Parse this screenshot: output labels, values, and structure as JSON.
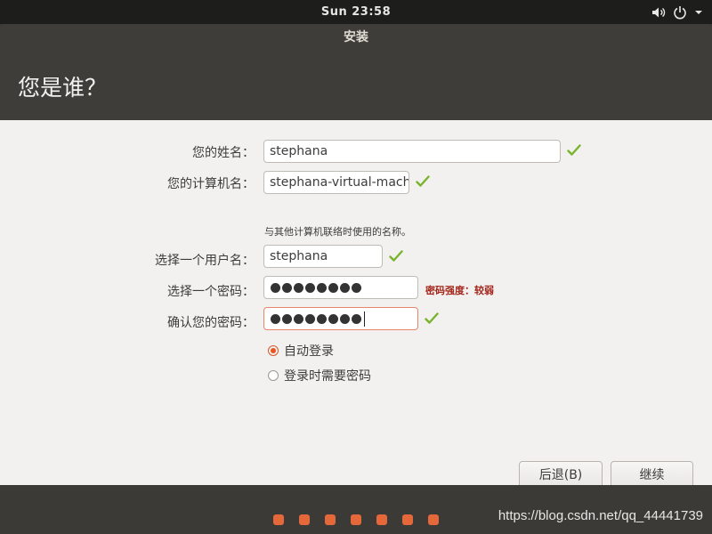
{
  "topbar": {
    "clock": "Sun 23:58",
    "icons": [
      "volume-icon",
      "power-icon",
      "chevron-down-icon"
    ]
  },
  "window": {
    "title": "安装",
    "page_title": "您是谁？"
  },
  "form": {
    "name": {
      "label": "您的姓名：",
      "value": "stephana",
      "valid": true
    },
    "computer": {
      "label": "您的计算机名：",
      "value": "stephana-virtual-mach",
      "valid": true,
      "hint": "与其他计算机联络时使用的名称。"
    },
    "username": {
      "label": "选择一个用户名：",
      "value": "stephana",
      "valid": true
    },
    "password": {
      "label": "选择一个密码：",
      "masked_length": 8,
      "strength": "密码强度：较弱"
    },
    "confirm": {
      "label": "确认您的密码：",
      "masked_length": 8,
      "valid": true
    }
  },
  "login_options": [
    {
      "label": "自动登录",
      "selected": true
    },
    {
      "label": "登录时需要密码",
      "selected": false
    }
  ],
  "buttons": {
    "back": "后退(B)",
    "continue": "继续"
  },
  "progress": {
    "total_steps": 7
  },
  "watermark": "https://blog.csdn.net/qq_44441739",
  "colors": {
    "accent": "#e95420",
    "check": "#7ab32c",
    "strength_text": "#a3261a"
  }
}
